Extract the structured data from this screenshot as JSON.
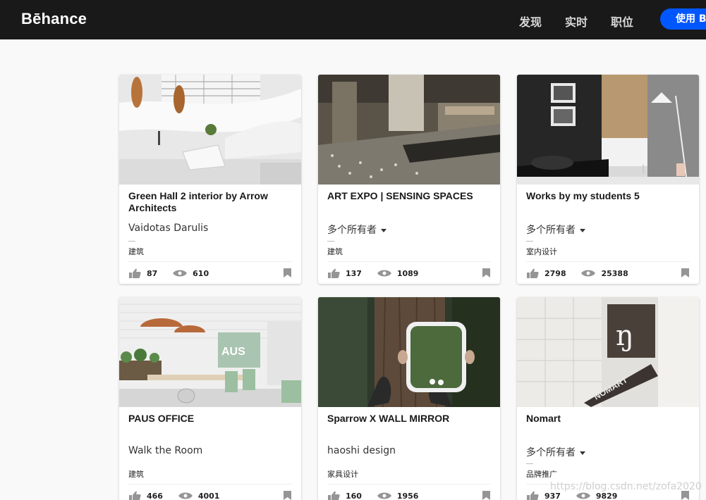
{
  "header": {
    "logo": "Bēhance",
    "nav": [
      "发现",
      "实时",
      "职位"
    ],
    "cta_label": "使用 B"
  },
  "icons": {
    "appreciate": "thumbs-up-icon",
    "views": "eye-icon",
    "save": "bookmark-icon",
    "owners_menu": "caret-down-icon"
  },
  "colors": {
    "header_bg": "#191919",
    "cta": "#0057ff",
    "icon_gray": "#959595"
  },
  "projects": [
    {
      "title": "Green Hall 2 interior by Arrow Architects",
      "owner": "Vaidotas Darulis",
      "field": "建筑",
      "appreciations": "87",
      "views": "610"
    },
    {
      "title": "ART EXPO | SENSING SPACES",
      "owner": "多个所有者",
      "field": "建筑",
      "appreciations": "137",
      "views": "1089"
    },
    {
      "title": "Works by my students 5",
      "owner": "多个所有者",
      "field": "室内设计",
      "appreciations": "2798",
      "views": "25388"
    },
    {
      "title": "PAUS OFFICE",
      "owner": "Walk the Room",
      "field": "建筑",
      "appreciations": "466",
      "views": "4001"
    },
    {
      "title": "Sparrow X WALL MIRROR",
      "owner": "haoshi design",
      "field": "家具设计",
      "appreciations": "160",
      "views": "1956"
    },
    {
      "title": "Nomart",
      "owner": "多个所有者",
      "field": "品牌推广",
      "appreciations": "937",
      "views": "9829"
    }
  ],
  "watermark": "https://blog.csdn.net/zofa2020"
}
